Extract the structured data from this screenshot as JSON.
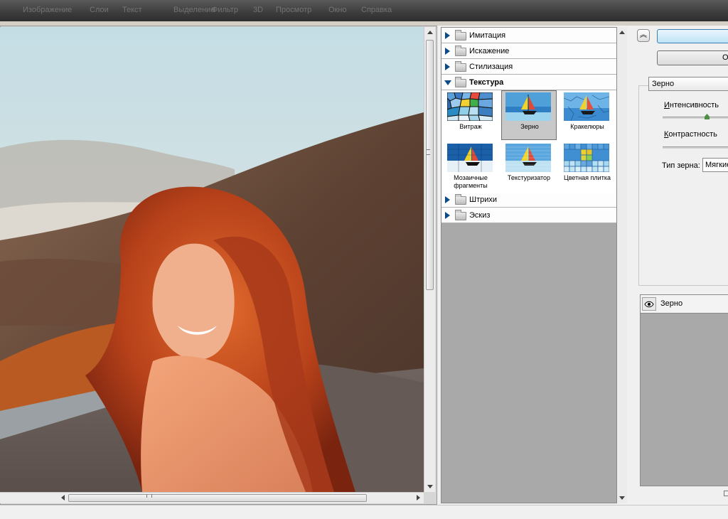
{
  "menubar": {
    "items": [
      "",
      "Изображение",
      "Слои",
      "Текст",
      "Выделение",
      "Фильтр",
      "3D",
      "Просмотр",
      "Окно",
      "Справка"
    ]
  },
  "gallery": {
    "categories_top": [
      {
        "label": "Имитация",
        "expanded": false
      },
      {
        "label": "Искажение",
        "expanded": false
      },
      {
        "label": "Стилизация",
        "expanded": false
      },
      {
        "label": "Текстура",
        "expanded": true
      }
    ],
    "texture_filters": [
      {
        "label": "Витраж",
        "icon": "stained-glass-thumb",
        "selected": false
      },
      {
        "label": "Зерно",
        "icon": "grain-thumb",
        "selected": true
      },
      {
        "label": "Кракелюры",
        "icon": "craquelure-thumb",
        "selected": false
      },
      {
        "label": "Мозаичные фрагменты",
        "icon": "mosaic-tiles-thumb",
        "selected": false
      },
      {
        "label": "Текстуризатор",
        "icon": "texturizer-thumb",
        "selected": false
      },
      {
        "label": "Цветная плитка",
        "icon": "patchwork-thumb",
        "selected": false
      }
    ],
    "categories_bottom": [
      {
        "label": "Штрихи",
        "expanded": false
      },
      {
        "label": "Эскиз",
        "expanded": false
      }
    ]
  },
  "panel": {
    "collapse_icon": "double-chevron-up-icon",
    "ok_label": "",
    "cancel_label": "О",
    "filter_select": "Зерно",
    "intensity_label": "Интенсивность",
    "intensity_value": 0.55,
    "contrast_label": "Контрастность",
    "grain_type_label": "Тип зерна:",
    "grain_type_value": "Мягкие",
    "layer_name": "Зерно",
    "eye_icon": "eye-icon"
  },
  "colors": {
    "accent_blue": "#0b4a86",
    "gallery_bg": "#a9a9a9",
    "slider_knob": "#4e8f41"
  }
}
